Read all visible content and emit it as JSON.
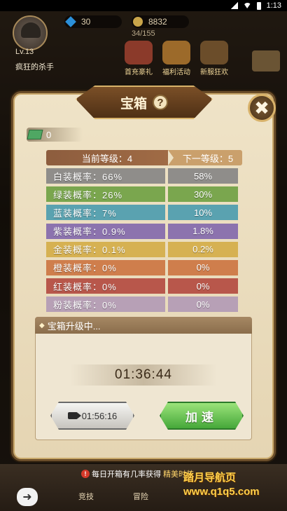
{
  "status_bar": {
    "time": "1:13"
  },
  "player": {
    "level": "Lv.13",
    "name": "疯狂的杀手"
  },
  "resources": {
    "gems": "30",
    "gold": "8832",
    "exp": "34/155"
  },
  "events": [
    {
      "label": "首充豪礼"
    },
    {
      "label": "福利活动"
    },
    {
      "label": "新服狂欢"
    }
  ],
  "modal": {
    "title": "宝箱",
    "help_icon": "?",
    "close_icon": "✖",
    "coins": "0",
    "current_level": "当前等级：4",
    "next_level": "下一等级：5",
    "rates": [
      {
        "current": "白装概率：66%",
        "next": "58%",
        "color": "#8f8d8a"
      },
      {
        "current": "绿装概率：26%",
        "next": "30%",
        "color": "#7aa64e"
      },
      {
        "current": "蓝装概率：7%",
        "next": "10%",
        "color": "#5aa2b0"
      },
      {
        "current": "紫装概率：0.9%",
        "next": "1.8%",
        "color": "#8c73ae"
      },
      {
        "current": "金装概率：0.1%",
        "next": "0.2%",
        "color": "#d6b152"
      },
      {
        "current": "橙装概率：0%",
        "next": "0%",
        "color": "#cf7e4c"
      },
      {
        "current": "红装概率：0%",
        "next": "0%",
        "color": "#b8574b"
      },
      {
        "current": "粉装概率：0%",
        "next": "0%",
        "color": "#b7a0b6"
      }
    ],
    "upgrade_title": "宝箱升级中...",
    "timer": "01:36:44",
    "video_time": "01:56:16",
    "speed_label": "加速"
  },
  "bottom": {
    "notice_prefix": "每日开箱有几率获得",
    "notice_highlight": "精美时装",
    "nav": [
      "竞技",
      "冒险"
    ]
  },
  "watermark": {
    "line1": "踏月导航页",
    "line2": "www.q1q5.com"
  }
}
